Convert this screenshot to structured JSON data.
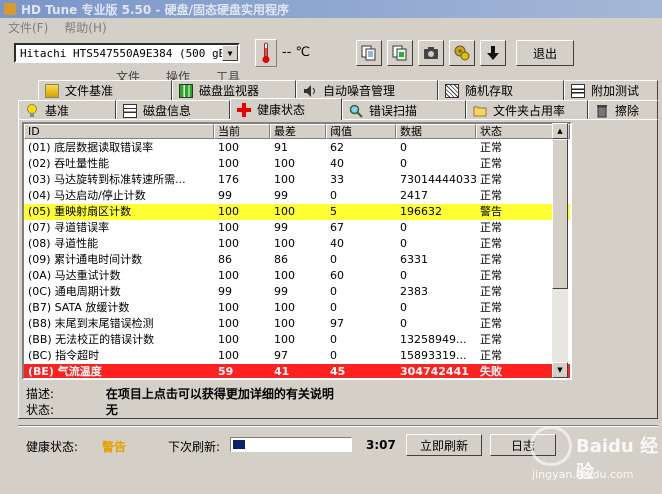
{
  "window": {
    "title": "HD Tune 专业版 5.50 - 硬盘/固态硬盘实用程序"
  },
  "menu": [
    "文件(F)",
    "帮助(H)"
  ],
  "toolbar": {
    "drive": "Hitachi HTS547550A9E384 (500 gB)",
    "temperature": "-- ℃",
    "exit_label": "退出"
  },
  "tabs": {
    "row0": [
      "文件",
      "操作",
      "工具"
    ],
    "row1": [
      "文件基准",
      "磁盘监视器",
      "自动噪音管理",
      "随机存取",
      "附加测试"
    ],
    "row2": [
      "基准",
      "磁盘信息",
      "健康状态",
      "错误扫描",
      "文件夹占用率",
      "擦除"
    ],
    "active": "健康状态"
  },
  "table": {
    "headers": [
      "ID",
      "当前",
      "最差",
      "阈值",
      "数据",
      "状态"
    ],
    "rows": [
      [
        "(01) 底层数据读取错误率",
        "100",
        "91",
        "62",
        "0",
        "正常"
      ],
      [
        "(02) 吞吐量性能",
        "100",
        "100",
        "40",
        "0",
        "正常"
      ],
      [
        "(03) 马达旋转到标准转速所需...",
        "176",
        "100",
        "33",
        "73014444033",
        "正常"
      ],
      [
        "(04) 马达启动/停止计数",
        "99",
        "99",
        "0",
        "2417",
        "正常"
      ],
      [
        "(05) 重映射扇区计数",
        "100",
        "100",
        "5",
        "196632",
        "警告"
      ],
      [
        "(07) 寻道错误率",
        "100",
        "99",
        "67",
        "0",
        "正常"
      ],
      [
        "(08) 寻道性能",
        "100",
        "100",
        "40",
        "0",
        "正常"
      ],
      [
        "(09) 累计通电时间计数",
        "86",
        "86",
        "0",
        "6331",
        "正常"
      ],
      [
        "(0A) 马达重试计数",
        "100",
        "100",
        "60",
        "0",
        "正常"
      ],
      [
        "(0C) 通电周期计数",
        "99",
        "99",
        "0",
        "2383",
        "正常"
      ],
      [
        "(B7) SATA 放缓计数",
        "100",
        "100",
        "0",
        "0",
        "正常"
      ],
      [
        "(B8) 末尾到末尾错误检测",
        "100",
        "100",
        "97",
        "0",
        "正常"
      ],
      [
        "(BB) 无法校正的错误计数",
        "100",
        "100",
        "0",
        "13258949...",
        "正常"
      ],
      [
        "(BC) 指令超时",
        "100",
        "97",
        "0",
        "15893319...",
        "正常"
      ],
      [
        "(BE) 气流温度",
        "59",
        "41",
        "45",
        "304742441",
        "失败"
      ]
    ]
  },
  "description": {
    "desc_label": "描述:",
    "desc_value": "在项目上点击可以获得更加详细的有关说明",
    "status_label": "状态:",
    "status_value": "无"
  },
  "footer": {
    "health_label": "健康状态:",
    "health_value": "警告",
    "refresh_label": "下次刷新:",
    "progress": 0.1,
    "time": "3:07",
    "refresh_button": "立即刷新",
    "log_button": "日志"
  },
  "watermark": {
    "brand": "Baidu 经验",
    "url": "jingyan.baidu.com"
  }
}
